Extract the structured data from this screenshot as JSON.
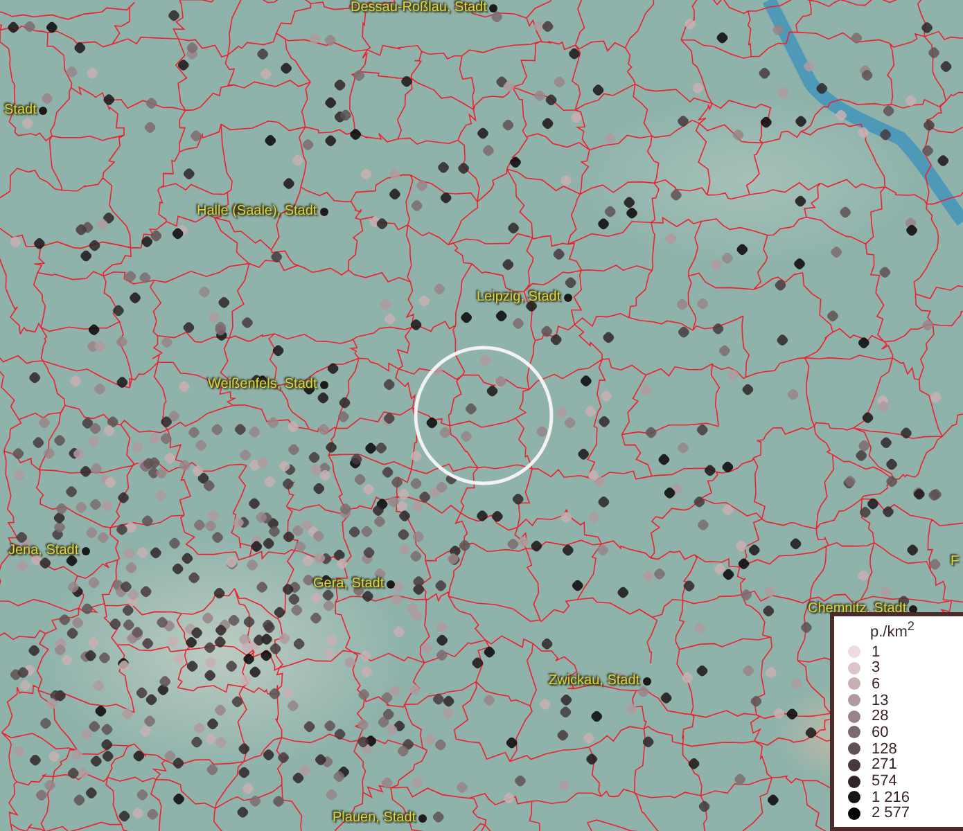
{
  "map": {
    "places": [
      {
        "name": "Dessau-Roßlau, Stadt"
      },
      {
        "name": "Stadt"
      },
      {
        "name": "Halle (Saale), Stadt"
      },
      {
        "name": "Leipzig, Stadt"
      },
      {
        "name": "Weißenfels, Stadt"
      },
      {
        "name": "Jena, Stadt"
      },
      {
        "name": "Gera, Stadt"
      },
      {
        "name": "Chemnitz, Stadt"
      },
      {
        "name": "Zwickau, Stadt"
      },
      {
        "name": "Plauen, Stadt"
      },
      {
        "name": "F"
      }
    ]
  },
  "legend": {
    "title": "p./km$^{2}$",
    "items": [
      {
        "label": "1",
        "color": "#eedbdd"
      },
      {
        "label": "3",
        "color": "#dcc4c7"
      },
      {
        "label": "6",
        "color": "#c8b0b3"
      },
      {
        "label": "13",
        "color": "#b09a9d"
      },
      {
        "label": "28",
        "color": "#988487"
      },
      {
        "label": "60",
        "color": "#7c6b6e"
      },
      {
        "label": "128",
        "color": "#5f5154"
      },
      {
        "label": "271",
        "color": "#463a3d"
      },
      {
        "label": "574",
        "color": "#2f2628"
      },
      {
        "label": "1 216",
        "color": "#1c1517"
      },
      {
        "label": "2 577",
        "color": "#090607"
      }
    ]
  }
}
